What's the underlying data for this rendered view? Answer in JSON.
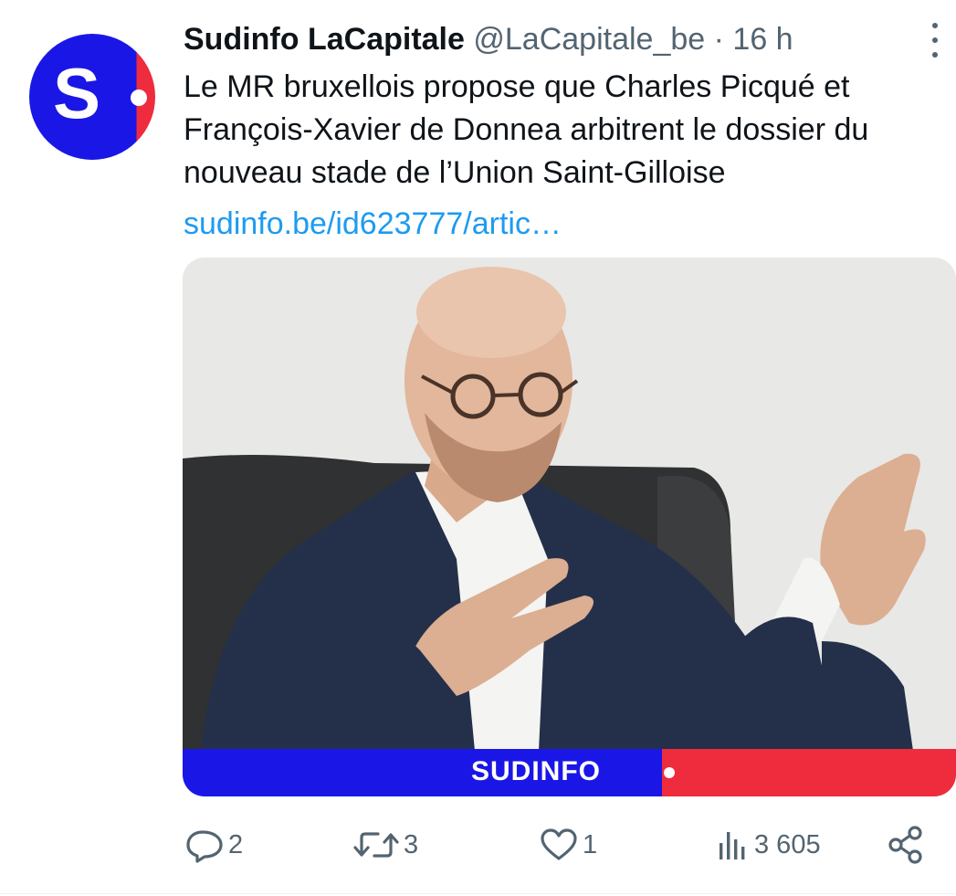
{
  "tweet": {
    "author_name": "Sudinfo LaCapitale",
    "handle": "@LaCapitale_be",
    "separator": "·",
    "time": "16 h",
    "text": "Le MR bruxellois propose que Charles Picqué et François-Xavier de Donnea arbitrent le dossier du nouveau stade de l’Union Saint-Gilloise",
    "link": "sudinfo.be/id623777/artic…",
    "media": {
      "banner_text": "SUDINFO"
    },
    "avatar_letter": "S"
  },
  "actions": {
    "replies": "2",
    "retweets": "3",
    "likes": "1",
    "views": "3 605"
  },
  "icons": {
    "more": "more-vertical-icon",
    "reply": "reply-icon",
    "retweet": "retweet-icon",
    "like": "heart-icon",
    "views": "views-bar-chart-icon",
    "share": "share-icon"
  },
  "colors": {
    "brand_blue": "#1a17e6",
    "brand_red": "#ef2b3e",
    "link": "#1d9bf0",
    "muted": "#536471"
  }
}
